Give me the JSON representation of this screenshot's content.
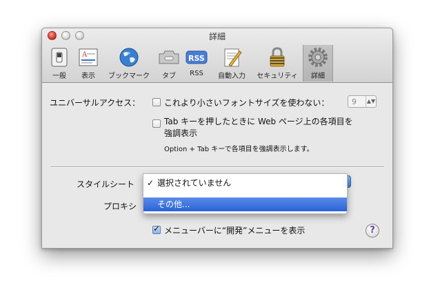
{
  "window": {
    "title": "詳細"
  },
  "toolbar": {
    "items": [
      {
        "label": "一般",
        "icon": "general-switch-icon"
      },
      {
        "label": "表示",
        "icon": "appearance-icon"
      },
      {
        "label": "ブックマーク",
        "icon": "globe-icon"
      },
      {
        "label": "タブ",
        "icon": "tabs-icon"
      },
      {
        "label": "RSS",
        "icon": "rss-icon"
      },
      {
        "label": "自動入力",
        "icon": "autofill-pencil-icon"
      },
      {
        "label": "セキュリティ",
        "icon": "padlock-icon"
      },
      {
        "label": "詳細",
        "icon": "gear-icon",
        "selected": true
      }
    ]
  },
  "universal_access": {
    "label": "ユニバーサルアクセス：",
    "min_font": {
      "label": "これより小さいフォントサイズを使わない：",
      "checked": false,
      "value": "9"
    },
    "tab_highlight": {
      "label_line1": "Tab キーを押したときに Web ページ上の各項目を",
      "label_line2": "強調表示",
      "checked": false,
      "hint": "Option + Tab キーで各項目を強調表示します。"
    }
  },
  "style_sheet": {
    "label": "スタイルシート",
    "menu_options": [
      {
        "label": "選択されていません",
        "selected": true
      },
      {
        "label": "その他...",
        "highlighted": true
      }
    ]
  },
  "proxy": {
    "label": "プロキシ"
  },
  "develop_menu": {
    "label": "メニューバーに“開発”メニューを表示",
    "checked": true
  },
  "help": {
    "label": "?"
  },
  "colors": {
    "accent": "#2a62d8",
    "window_bg": "#e8e8e8"
  }
}
